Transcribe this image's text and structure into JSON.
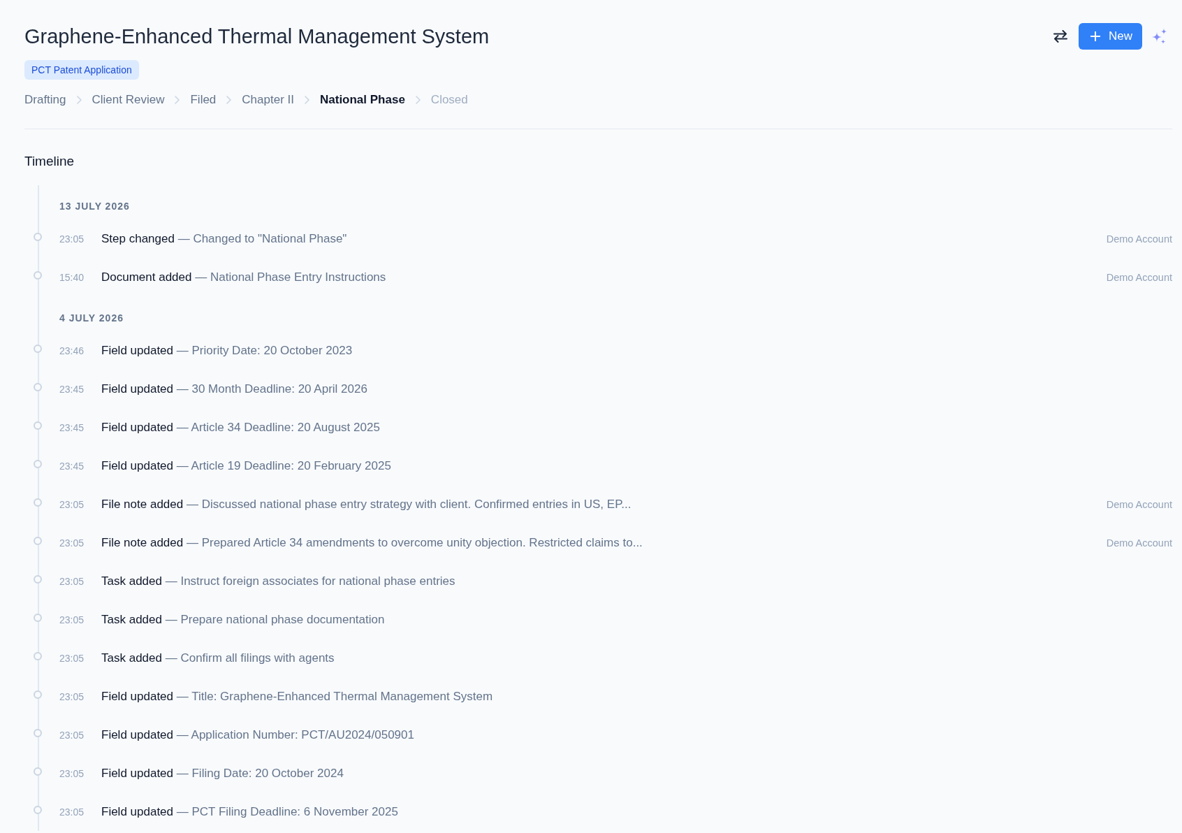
{
  "header": {
    "title": "Graphene-Enhanced Thermal Management System",
    "badge": "PCT Patent Application",
    "new_button": {
      "label": "New"
    }
  },
  "steps": [
    {
      "label": "Drafting",
      "completed": true,
      "selected": false
    },
    {
      "label": "Client Review",
      "completed": true,
      "selected": false
    },
    {
      "label": "Filed",
      "completed": true,
      "selected": false
    },
    {
      "label": "Chapter II",
      "completed": true,
      "selected": false
    },
    {
      "label": "National Phase",
      "completed": false,
      "selected": true
    },
    {
      "label": "Closed",
      "completed": false,
      "selected": false
    }
  ],
  "timeline": {
    "title": "Timeline",
    "groups": [
      {
        "date": "13 JULY 2026",
        "events": [
          {
            "time": "23:05",
            "action": "Step changed",
            "detail": "— Changed to \"National Phase\"",
            "user": "Demo Account"
          },
          {
            "time": "15:40",
            "action": "Document added",
            "detail": "— National Phase Entry Instructions",
            "user": "Demo Account"
          }
        ]
      },
      {
        "date": "4 JULY 2026",
        "events": [
          {
            "time": "23:46",
            "action": "Field updated",
            "detail": "— Priority Date: 20 October 2023"
          },
          {
            "time": "23:45",
            "action": "Field updated",
            "detail": "— 30 Month Deadline: 20 April 2026"
          },
          {
            "time": "23:45",
            "action": "Field updated",
            "detail": "— Article 34 Deadline: 20 August 2025"
          },
          {
            "time": "23:45",
            "action": "Field updated",
            "detail": "— Article 19 Deadline: 20 February 2025"
          },
          {
            "time": "23:05",
            "action": "File note added",
            "detail": "— Discussed national phase entry strategy with client. Confirmed entries in US, EP...",
            "user": "Demo Account"
          },
          {
            "time": "23:05",
            "action": "File note added",
            "detail": "— Prepared Article 34 amendments to overcome unity objection. Restricted claims to...",
            "user": "Demo Account"
          },
          {
            "time": "23:05",
            "action": "Task added",
            "detail": "— Instruct foreign associates for national phase entries"
          },
          {
            "time": "23:05",
            "action": "Task added",
            "detail": "— Prepare national phase documentation"
          },
          {
            "time": "23:05",
            "action": "Task added",
            "detail": "— Confirm all filings with agents"
          },
          {
            "time": "23:05",
            "action": "Field updated",
            "detail": "— Title: Graphene-Enhanced Thermal Management System"
          },
          {
            "time": "23:05",
            "action": "Field updated",
            "detail": "— Application Number: PCT/AU2024/050901"
          },
          {
            "time": "23:05",
            "action": "Field updated",
            "detail": "— Filing Date: 20 October 2024"
          },
          {
            "time": "23:05",
            "action": "Field updated",
            "detail": "— PCT Filing Deadline: 6 November 2025"
          }
        ]
      }
    ]
  }
}
